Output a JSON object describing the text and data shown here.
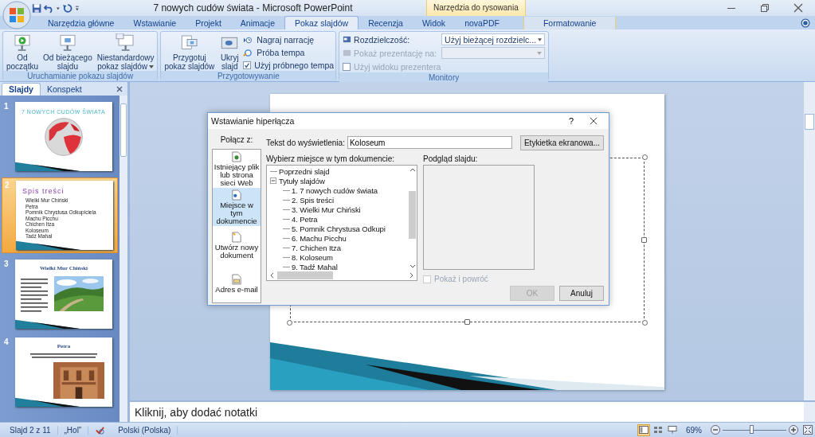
{
  "window": {
    "title": "7 nowych cudów świata - Microsoft PowerPoint",
    "contextual_header": "Narzędzia do rysowania"
  },
  "tabs": [
    {
      "label": "Narzędzia główne",
      "selected": false,
      "contextual": false
    },
    {
      "label": "Wstawianie",
      "selected": false,
      "contextual": false
    },
    {
      "label": "Projekt",
      "selected": false,
      "contextual": false
    },
    {
      "label": "Animacje",
      "selected": false,
      "contextual": false
    },
    {
      "label": "Pokaz slajdów",
      "selected": true,
      "contextual": false
    },
    {
      "label": "Recenzja",
      "selected": false,
      "contextual": false
    },
    {
      "label": "Widok",
      "selected": false,
      "contextual": false
    },
    {
      "label": "novaPDF",
      "selected": false,
      "contextual": false
    },
    {
      "label": "Formatowanie",
      "selected": false,
      "contextual": true
    }
  ],
  "ribbon": {
    "start_group": {
      "label": "Uruchamianie pokazu slajdów",
      "buttons": [
        {
          "lines": [
            "Od",
            "początku"
          ],
          "dropdown": false
        },
        {
          "lines": [
            "Od bieżącego",
            "slajdu"
          ],
          "dropdown": false
        },
        {
          "lines": [
            "Niestandardowy",
            "pokaz slajdów"
          ],
          "dropdown": true
        }
      ]
    },
    "setup_group": {
      "label": "Przygotowywanie",
      "buttons": [
        {
          "lines": [
            "Przygotuj",
            "pokaz slajdów"
          ]
        },
        {
          "lines": [
            "Ukryj",
            "slajd"
          ]
        }
      ],
      "small": [
        {
          "kind": "button",
          "label": "Nagraj narrację"
        },
        {
          "kind": "button",
          "label": "Próba tempa"
        },
        {
          "kind": "checkbox",
          "label": "Użyj próbnego tempa",
          "checked": true
        }
      ]
    },
    "monitors_group": {
      "label": "Monitory",
      "resolution": {
        "label": "Rozdzielczość:",
        "value": "Użyj bieżącej rozdzielc...",
        "disabled": false
      },
      "show_on": {
        "label": "Pokaż prezentację na:",
        "disabled": true
      },
      "presenter_view": {
        "label": "Użyj widoku prezentera",
        "checked": false,
        "disabled": true
      }
    }
  },
  "slides_panel": {
    "tabs": [
      {
        "label": "Slajdy",
        "selected": true
      },
      {
        "label": "Konspekt",
        "selected": false
      }
    ],
    "thumbnails": [
      {
        "number": "1",
        "selected": false,
        "kind": "title",
        "title": "7 NOWYCH CUDÓW ŚWIATA"
      },
      {
        "number": "2",
        "selected": true,
        "kind": "list",
        "title": "Spis treści",
        "items": [
          "Wielki Mur Chiński",
          "Petra",
          "Pomnik Chrystusa Odkupiciela",
          "Machu Picchu",
          "Chichen Itza",
          "Koloseum",
          "Tadź Mahal"
        ]
      },
      {
        "number": "3",
        "selected": false,
        "kind": "side-picture",
        "title": "Wielki Mur Chiński"
      },
      {
        "number": "4",
        "selected": false,
        "kind": "bottom-picture",
        "title": "Petra"
      }
    ]
  },
  "notes": {
    "placeholder": "Kliknij, aby dodać notatki"
  },
  "dialog": {
    "title": "Wstawianie hiperłącza",
    "help": "?",
    "link_to_label": "Połącz z:",
    "link_to": [
      {
        "label": "Istniejący plik lub strona sieci Web",
        "selected": false
      },
      {
        "label": "Miejsce w tym dokumencie",
        "selected": true
      },
      {
        "label": "Utwórz nowy dokument",
        "selected": false
      },
      {
        "label": "Adres e-mail",
        "selected": false
      }
    ],
    "display_text": {
      "label": "Tekst do wyświetlenia:",
      "value": "Koloseum"
    },
    "screen_tip_button": "Etykietka ekranowa...",
    "place_label": "Wybierz miejsce w tym dokumencie:",
    "tree": [
      {
        "label": "Poprzedni slajd"
      },
      {
        "label": "Tytuły slajdów",
        "expanded": true,
        "children": [
          {
            "label": "1. 7 nowych cudów świata"
          },
          {
            "label": "2. Spis treści"
          },
          {
            "label": "3. Wielki Mur Chiński"
          },
          {
            "label": "4. Petra"
          },
          {
            "label": "5. Pomnik Chrystusa Odkupi"
          },
          {
            "label": "6. Machu Picchu"
          },
          {
            "label": "7. Chichen Itza"
          },
          {
            "label": "8. Koloseum"
          },
          {
            "label": "9. Tadź Mahal"
          }
        ]
      }
    ],
    "preview_label": "Podgląd slajdu:",
    "show_and_return": {
      "label": "Pokaż i powróć",
      "checked": false,
      "disabled": true
    },
    "buttons": [
      {
        "label": "OK",
        "disabled": true
      },
      {
        "label": "Anuluj",
        "disabled": false
      }
    ]
  },
  "status_bar": {
    "slide": "Slajd 2 z 11",
    "theme": "„Hol”",
    "language": "Polski (Polska)",
    "views": [
      {
        "selected": true
      },
      {
        "selected": false
      },
      {
        "selected": false
      }
    ],
    "zoom": "69%",
    "zoom_slider": {
      "level": 0.45
    }
  }
}
